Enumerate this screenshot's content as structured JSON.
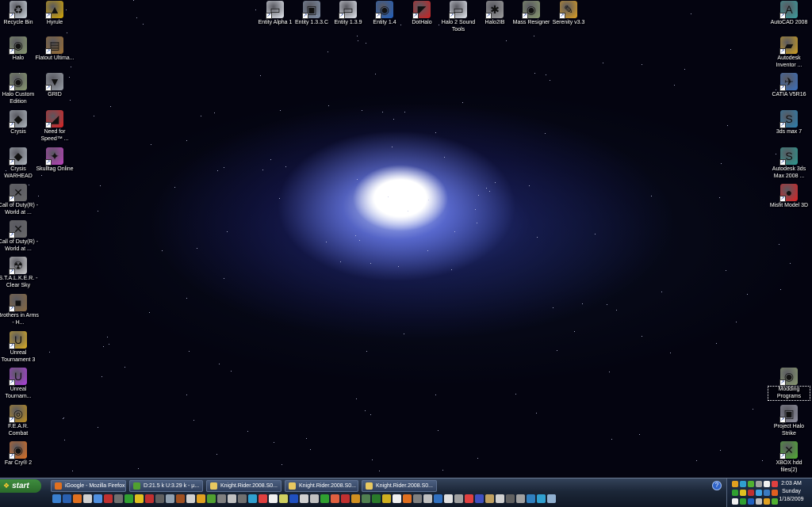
{
  "desktop": {
    "left_icons": [
      {
        "label": "Recycle Bin",
        "icon": "recycle-bin-icon",
        "color": "#cfd8e0",
        "glyph": "♻"
      },
      {
        "label": "Hyrule",
        "icon": "triforce-icon",
        "color": "#d8a800",
        "glyph": "▲"
      },
      {
        "label": "Halo",
        "icon": "halo-icon",
        "color": "#8a9a70",
        "glyph": "◉"
      },
      {
        "label": "Flatout Ultima...",
        "icon": "flatout-icon",
        "color": "#a07030",
        "glyph": "▤"
      },
      {
        "label": "Halo Custom Edition",
        "icon": "halo-ce-icon",
        "color": "#8a9a70",
        "glyph": "◉"
      },
      {
        "label": "GRID",
        "icon": "grid-icon",
        "color": "#9aa0a8",
        "glyph": "▼"
      },
      {
        "label": "Crysis",
        "icon": "crysis-icon",
        "color": "#b0b8c0",
        "glyph": "◆"
      },
      {
        "label": "Need for Speed™ ...",
        "icon": "nfs-icon",
        "color": "#e02020",
        "glyph": "◢"
      },
      {
        "label": "Crysis WARHEAD",
        "icon": "crysis-warhead-icon",
        "color": "#b0b8c0",
        "glyph": "◆"
      },
      {
        "label": "Skulltag Online",
        "icon": "skulltag-icon",
        "color": "#c040c0",
        "glyph": "✦"
      },
      {
        "label": "Call of Duty(R) - World at ...",
        "icon": "cod-icon",
        "color": "#6a6a6a",
        "glyph": "✕"
      },
      {
        "label": "Call of Duty(R) - World at ...",
        "icon": "cod-icon",
        "color": "#6a6a6a",
        "glyph": "✕"
      },
      {
        "label": "S.T.A.L.K.E.R. - Clear Sky",
        "icon": "stalker-icon",
        "color": "#d0d0d0",
        "glyph": "☢"
      },
      {
        "label": "Brothers in Arms - H...",
        "icon": "brothers-in-arms-icon",
        "color": "#8a6a40",
        "glyph": "■"
      },
      {
        "label": "Unreal Tournament 3",
        "icon": "unreal-icon",
        "color": "#e0b020",
        "glyph": "U"
      },
      {
        "label": "Unreal Tournam...",
        "icon": "unreal-icon",
        "color": "#b040e0",
        "glyph": "U"
      },
      {
        "label": "F.E.A.R. Combat",
        "icon": "fear-icon",
        "color": "#c09020",
        "glyph": "◎"
      },
      {
        "label": "Far Cry® 2",
        "icon": "farcry-icon",
        "color": "#e07020",
        "glyph": "◉"
      }
    ],
    "top_icons": [
      {
        "label": "Entity Alpha 1",
        "icon": "window-app-icon",
        "color": "#e8ecf4",
        "glyph": "▭"
      },
      {
        "label": "Entity 1.3.3.C",
        "icon": "cube-app-icon",
        "color": "#8090a8",
        "glyph": "▣"
      },
      {
        "label": "Entity 1.3.9",
        "icon": "window-app-icon",
        "color": "#e8ecf4",
        "glyph": "▭"
      },
      {
        "label": "Entity 1.4",
        "icon": "globe-app-icon",
        "color": "#2060c0",
        "glyph": "◉"
      },
      {
        "label": "DotHalo",
        "icon": "dothalo-icon",
        "color": "#d02020",
        "glyph": "◤"
      },
      {
        "label": "Halo 2 Sound Tools",
        "icon": "window-app-icon",
        "color": "#e8ecf4",
        "glyph": "▭"
      },
      {
        "label": "Halo2IB",
        "icon": "halo2ib-icon",
        "color": "#a0a0a0",
        "glyph": "✱"
      },
      {
        "label": "Mass Resigner",
        "icon": "mass-resigner-icon",
        "color": "#8a9a70",
        "glyph": "◉"
      },
      {
        "label": "Serenity v3.3",
        "icon": "serenity-icon",
        "color": "#e0a020",
        "glyph": "✎"
      }
    ],
    "right_icons": [
      {
        "label": "AutoCAD 2008",
        "icon": "autocad-icon",
        "color": "#3aa0a0",
        "glyph": "A"
      },
      {
        "label": "Autodesk Inventor ...",
        "icon": "inventor-icon",
        "color": "#d0a020",
        "glyph": "▰"
      },
      {
        "label": "CATIA V5R16",
        "icon": "catia-icon",
        "color": "#3a70c0",
        "glyph": "✈"
      },
      {
        "label": "3ds max 7",
        "icon": "3dsmax-icon",
        "color": "#2a80b0",
        "glyph": "S"
      },
      {
        "label": "Autodesk 3ds Max 2008 ...",
        "icon": "3dsmax-2008-icon",
        "color": "#2a9a90",
        "glyph": "S"
      },
      {
        "label": "Misfit Model 3D",
        "icon": "misfit-icon",
        "color": "#e02020",
        "glyph": "●"
      }
    ],
    "right_bottom_icons": [
      {
        "label": "Modding Programs",
        "icon": "folder-halo-icon",
        "color": "#8a9a70",
        "glyph": "◉"
      },
      {
        "label": "Project Halo Strike",
        "icon": "halo-strike-icon",
        "color": "#9090a0",
        "glyph": "▣"
      },
      {
        "label": "XBOX hdd files(2)",
        "icon": "xbox-icon",
        "color": "#50b030",
        "glyph": "✕"
      }
    ]
  },
  "taskbar": {
    "start_label": "start",
    "tasks": [
      {
        "label": "iGoogle - Mozilla Firefox",
        "icon": "firefox-icon",
        "color": "#e07020"
      },
      {
        "label": "D:21.5 k U:3.29 k - µ...",
        "icon": "utorrent-icon",
        "color": "#50a030"
      },
      {
        "label": "Knight.Rider.2008.S0...",
        "icon": "folder-icon",
        "color": "#e8c860"
      },
      {
        "label": "Knight.Rider.2008.S0...",
        "icon": "folder-icon",
        "color": "#e8c860"
      },
      {
        "label": "Knight.Rider.2008.S0...",
        "icon": "folder-icon",
        "color": "#e8c860"
      }
    ],
    "quicklaunch_colors": [
      "#3a80d0",
      "#2a60b0",
      "#e07020",
      "#d0d0d0",
      "#5090e0",
      "#c03030",
      "#707070",
      "#30a030",
      "#e0c020",
      "#c03030",
      "#606060",
      "#90a0b0",
      "#a05020",
      "#d0d0d0",
      "#e0a020",
      "#50a030",
      "#808080",
      "#c0c0c0",
      "#707070",
      "#30a0d0",
      "#e04040",
      "#f0f0f0",
      "#d0d060",
      "#2050c0",
      "#d0d0d0",
      "#c0c0c0",
      "#30a030",
      "#e06040",
      "#c03030",
      "#d09020",
      "#508050",
      "#2a7a2a",
      "#d0b020",
      "#f0f0f0",
      "#e07020",
      "#808080",
      "#c0c0c0",
      "#3070c0",
      "#e0e0e0",
      "#a0a0a0",
      "#e04040",
      "#4050c0",
      "#c0a060",
      "#d0d0d0",
      "#606060",
      "#a0a0a0",
      "#3080c0",
      "#30a0d0",
      "#90b0d0"
    ],
    "tray_colors": [
      "#e0a020",
      "#30a0d0",
      "#50b030",
      "#a0a0a0",
      "#f0f0f0",
      "#e04040",
      "#30a030",
      "#e0c020",
      "#c03030",
      "#40a0e0",
      "#3a7ac0",
      "#e06020",
      "#f0f0f0",
      "#30a030",
      "#2060c0",
      "#c0c0c0",
      "#e0a020",
      "#50b030"
    ],
    "clock": {
      "time": "2:03 AM",
      "day": "Sunday",
      "date": "1/18/2009"
    }
  }
}
